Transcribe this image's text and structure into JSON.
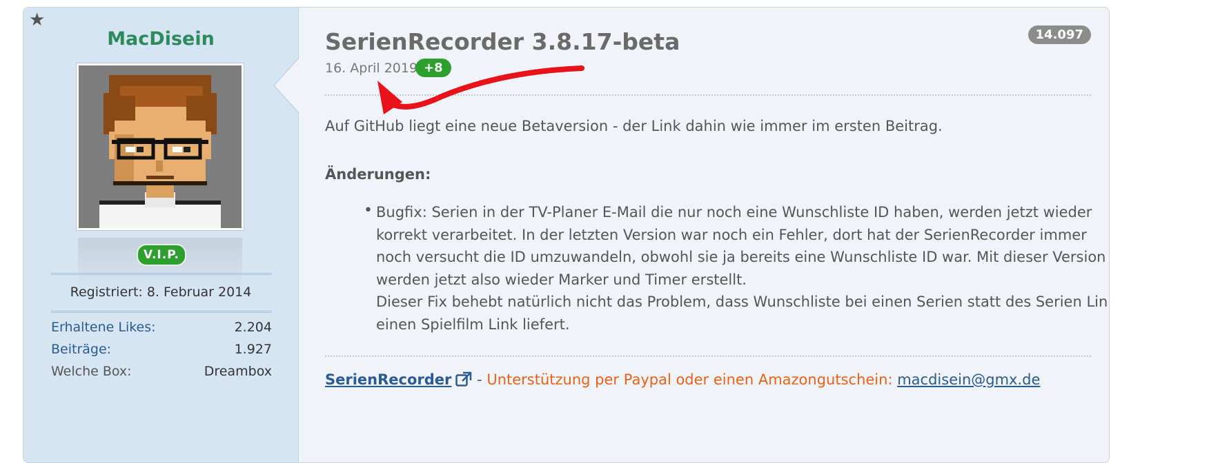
{
  "sidebar": {
    "username": "MacDisein",
    "badge": "V.I.P.",
    "registered": "Registriert: 8. Februar 2014",
    "stats": [
      {
        "label": "Erhaltene Likes:",
        "value": "2.204"
      },
      {
        "label": "Beiträge:",
        "value": "1.927"
      },
      {
        "label": "Welche Box:",
        "value": "Dreambox"
      }
    ]
  },
  "post": {
    "title": "SerienRecorder 3.8.17-beta",
    "date": "16. April 2019",
    "likes": "+8",
    "counter": "14.097",
    "intro": "Auf GitHub liegt eine neue Betaversion - der Link dahin wie immer im ersten Beitrag.",
    "changes_heading": "Änderungen:",
    "bullet_lines": [
      "Bugfix: Serien in der TV-Planer E-Mail die nur noch eine Wunschliste ID haben, werden jetzt wieder",
      "korrekt verarbeitet. In der letzten Version war noch ein Fehler, dort hat der SerienRecorder immer",
      "noch versucht die ID umzuwandeln, obwohl sie ja bereits eine Wunschliste ID war. Mit dieser Version",
      "werden jetzt also wieder Marker und Timer erstellt.",
      "Dieser Fix behebt natürlich nicht das Problem, dass Wunschliste bei einen Serien statt des Serien Links",
      "einen Spielfilm Link liefert."
    ]
  },
  "signature": {
    "link_label": "SerienRecorder",
    "dash": " - ",
    "support_text": "Unterstützung per Paypal oder einen Amazongutschein",
    "colon": ": ",
    "email": "macdisein@gmx.de"
  },
  "colors": {
    "accent_green": "#2e9e2e",
    "username_green": "#2d8a5b",
    "link_blue": "#2a5b92",
    "support_orange": "#e8621a",
    "annotation_red": "#e8121a",
    "sidebar_bg": "#d6e5f3"
  },
  "icons": {
    "star": "star-icon",
    "external_link": "external-link-icon",
    "annotation_arrow": "red-arrow"
  }
}
